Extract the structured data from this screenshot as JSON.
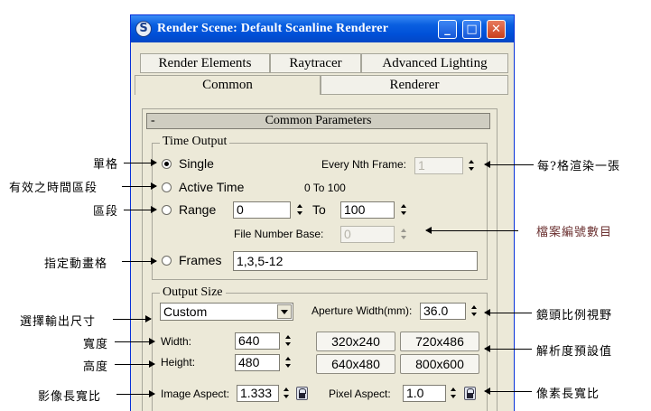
{
  "window": {
    "title": "Render Scene: Default Scanline Renderer",
    "minimize": "_",
    "maximize": "□",
    "close": "✕"
  },
  "tabs": {
    "row1": [
      "Render Elements",
      "Raytracer",
      "Advanced Lighting"
    ],
    "row2": [
      "Common",
      "Renderer"
    ],
    "active": "Common"
  },
  "rollout": {
    "toggle": "-",
    "title": "Common Parameters"
  },
  "time_output": {
    "title": "Time Output",
    "single_label": "Single",
    "every_nth_label": "Every Nth Frame:",
    "every_nth_value": "1",
    "active_time_label": "Active Time",
    "active_time_range": "0 To 100",
    "range_label": "Range",
    "range_from": "0",
    "range_to_label": "To",
    "range_to": "100",
    "file_number_base_label": "File Number Base:",
    "file_number_base_value": "0",
    "frames_label": "Frames",
    "frames_value": "1,3,5-12",
    "selected": "Single"
  },
  "output_size": {
    "title": "Output Size",
    "preset": "Custom",
    "aperture_label": "Aperture Width(mm):",
    "aperture_value": "36.0",
    "width_label": "Width:",
    "width_value": "640",
    "height_label": "Height:",
    "height_value": "480",
    "presets": [
      "320x240",
      "720x486",
      "640x480",
      "800x600"
    ],
    "image_aspect_label": "Image Aspect:",
    "image_aspect_value": "1.333",
    "pixel_aspect_label": "Pixel Aspect:",
    "pixel_aspect_value": "1.0"
  },
  "annotations": {
    "left": [
      "單格",
      "有效之時間區段",
      "區段",
      "指定動畫格",
      "選擇輸出尺寸",
      "寬度",
      "高度",
      "影像長寬比"
    ],
    "right": [
      "每?格渲染一張",
      "檔案編號數目",
      "鏡頭比例視野",
      "解析度預設值",
      "像素長寬比"
    ]
  },
  "colors": {
    "titlebar": "#0a5fe0",
    "dialog_bg": "#ece9d8",
    "close_button": "#c93f1c"
  }
}
